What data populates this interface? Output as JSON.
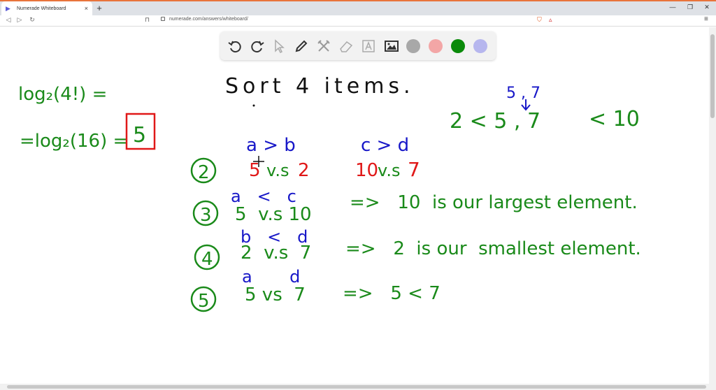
{
  "browser": {
    "tab_title": "Numerade Whiteboard",
    "tab_close": "×",
    "new_tab": "+",
    "url": "numerade.com/answers/whiteboard/",
    "win_minimize": "—",
    "win_restore": "❐",
    "win_close": "✕",
    "back": "◁",
    "forward": "▷",
    "reload": "↻",
    "bookmark": "⊓",
    "menu": "≡"
  },
  "toolbar_icons": [
    "undo-icon",
    "redo-icon",
    "pointer-icon",
    "pen-icon",
    "tools-icon",
    "eraser-icon",
    "text-icon",
    "image-icon"
  ],
  "colors": {
    "swatch_gray": "#a8a8a8",
    "swatch_pink": "#f3a6a6",
    "swatch_green": "#0a8a0a",
    "swatch_lavender": "#b6b6ee",
    "ink_black": "#111111",
    "ink_green": "#1a8a1a",
    "ink_blue": "#1717c8",
    "ink_red": "#e01818"
  },
  "whiteboard": {
    "log_line1": "log₂(4!) =",
    "log_line2": "=log₂(16) =",
    "answer": "5",
    "title": "Sort 4 items.",
    "insert_label": "5 , 7",
    "ordering_a": "2 < 5 , 7",
    "ordering_b": "< 10",
    "step_2": {
      "number": "2",
      "top_left": "a > b",
      "top_right": "c > d",
      "left_a": "5",
      "left_vs": "v.s",
      "left_b": "2",
      "right_a": "10",
      "right_vs": "v.s",
      "right_b": "7"
    },
    "step_3": {
      "number": "3",
      "labels": "a   <   c",
      "comparison": "5  v.s 10",
      "result": "=>   10  is our largest element."
    },
    "step_4": {
      "number": "4",
      "labels": "b   <   d",
      "comparison": "2  v.s  7",
      "result": "=>   2  is our  smallest element."
    },
    "step_5": {
      "number": "5",
      "labels": "a       d",
      "comparison": "5 vs  7",
      "result": "=>   5 < 7"
    }
  }
}
